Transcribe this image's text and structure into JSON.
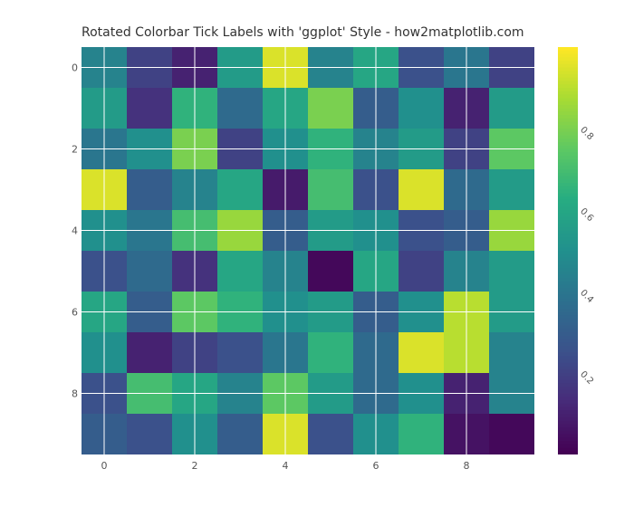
{
  "chart_data": {
    "type": "heatmap",
    "title": "Rotated Colorbar Tick Labels with 'ggplot' Style - how2matplotlib.com",
    "xlabel": "",
    "ylabel": "",
    "cmap": "viridis",
    "rows": 10,
    "cols": 10,
    "xticks": [
      0,
      2,
      4,
      6,
      8
    ],
    "yticks": [
      0,
      2,
      4,
      6,
      8
    ],
    "colorbar_ticks": [
      0.2,
      0.4,
      0.6,
      0.8
    ],
    "colorbar_range": [
      0.0,
      1.0
    ],
    "values": [
      [
        0.45,
        0.2,
        0.1,
        0.55,
        0.95,
        0.45,
        0.6,
        0.25,
        0.4,
        0.2
      ],
      [
        0.55,
        0.15,
        0.65,
        0.35,
        0.6,
        0.8,
        0.3,
        0.5,
        0.1,
        0.55
      ],
      [
        0.4,
        0.5,
        0.8,
        0.2,
        0.5,
        0.65,
        0.45,
        0.55,
        0.2,
        0.75
      ],
      [
        0.95,
        0.3,
        0.45,
        0.6,
        0.08,
        0.7,
        0.25,
        0.95,
        0.35,
        0.55
      ],
      [
        0.5,
        0.4,
        0.7,
        0.85,
        0.3,
        0.55,
        0.5,
        0.25,
        0.3,
        0.85
      ],
      [
        0.25,
        0.35,
        0.15,
        0.6,
        0.45,
        0.02,
        0.6,
        0.2,
        0.45,
        0.55
      ],
      [
        0.6,
        0.3,
        0.75,
        0.65,
        0.5,
        0.55,
        0.3,
        0.5,
        0.9,
        0.55
      ],
      [
        0.5,
        0.1,
        0.2,
        0.25,
        0.4,
        0.65,
        0.35,
        0.95,
        0.9,
        0.45
      ],
      [
        0.25,
        0.7,
        0.6,
        0.45,
        0.75,
        0.55,
        0.35,
        0.5,
        0.1,
        0.45
      ],
      [
        0.3,
        0.25,
        0.5,
        0.3,
        0.95,
        0.25,
        0.5,
        0.65,
        0.05,
        0.02
      ]
    ]
  }
}
